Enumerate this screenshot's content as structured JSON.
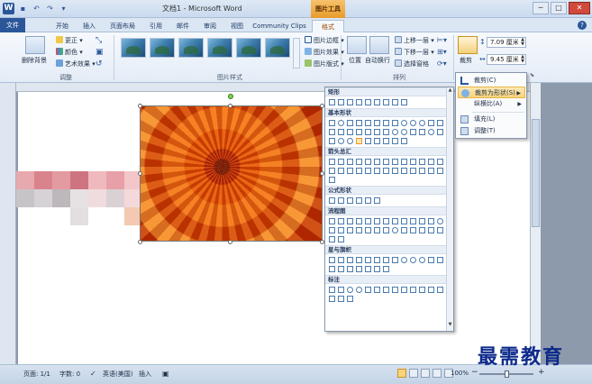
{
  "window": {
    "app_icon": "W",
    "title": "文档1 - Microsoft Word",
    "context_tab_group": "图片工具",
    "minimize": "─",
    "maximize": "□",
    "close": "✕"
  },
  "quick_access": [
    "save-icon",
    "undo-icon",
    "redo-icon",
    "customize-icon"
  ],
  "tabs": [
    {
      "label": "文件"
    },
    {
      "label": "开始"
    },
    {
      "label": "插入"
    },
    {
      "label": "页面布局"
    },
    {
      "label": "引用"
    },
    {
      "label": "邮件"
    },
    {
      "label": "审阅"
    },
    {
      "label": "视图"
    },
    {
      "label": "Community Clips"
    },
    {
      "label": "格式"
    }
  ],
  "help": "?",
  "ribbon": {
    "remove_bg": "删除背景",
    "corrections": "更正 ▾",
    "color": "颜色 ▾",
    "artistic": "艺术效果 ▾",
    "group_adjust": "调整",
    "picture_border": "图片边框 ▾",
    "picture_effects": "图片效果 ▾",
    "picture_layout": "图片版式 ▾",
    "group_styles": "图片样式",
    "position": "位置",
    "wrap_text": "自动换行",
    "bring_forward": "上移一层 ▾",
    "send_backward": "下移一层 ▾",
    "selection_pane": "选择窗格",
    "group_arrange": "排列",
    "crop": "裁剪",
    "height": "7.09 厘米",
    "width": "9.45 厘米"
  },
  "shapes_panel": {
    "categories": [
      "矩形",
      "基本形状",
      "箭头总汇",
      "公式形状",
      "流程图",
      "星与旗帜",
      "标注"
    ]
  },
  "crop_menu": {
    "items": [
      "裁剪(C)",
      "裁剪为形状(S)",
      "纵横比(A)",
      "填充(L)",
      "调整(T)"
    ]
  },
  "status": {
    "page": "页面: 1/1",
    "words": "字数: 0",
    "language": "英语(美国)",
    "mode": "插入",
    "zoom": "100%"
  },
  "watermark": "最需教育",
  "colors": {
    "accent": "#2b579a",
    "context_tab": "#e89b2b",
    "highlight": "#f9d37a"
  }
}
